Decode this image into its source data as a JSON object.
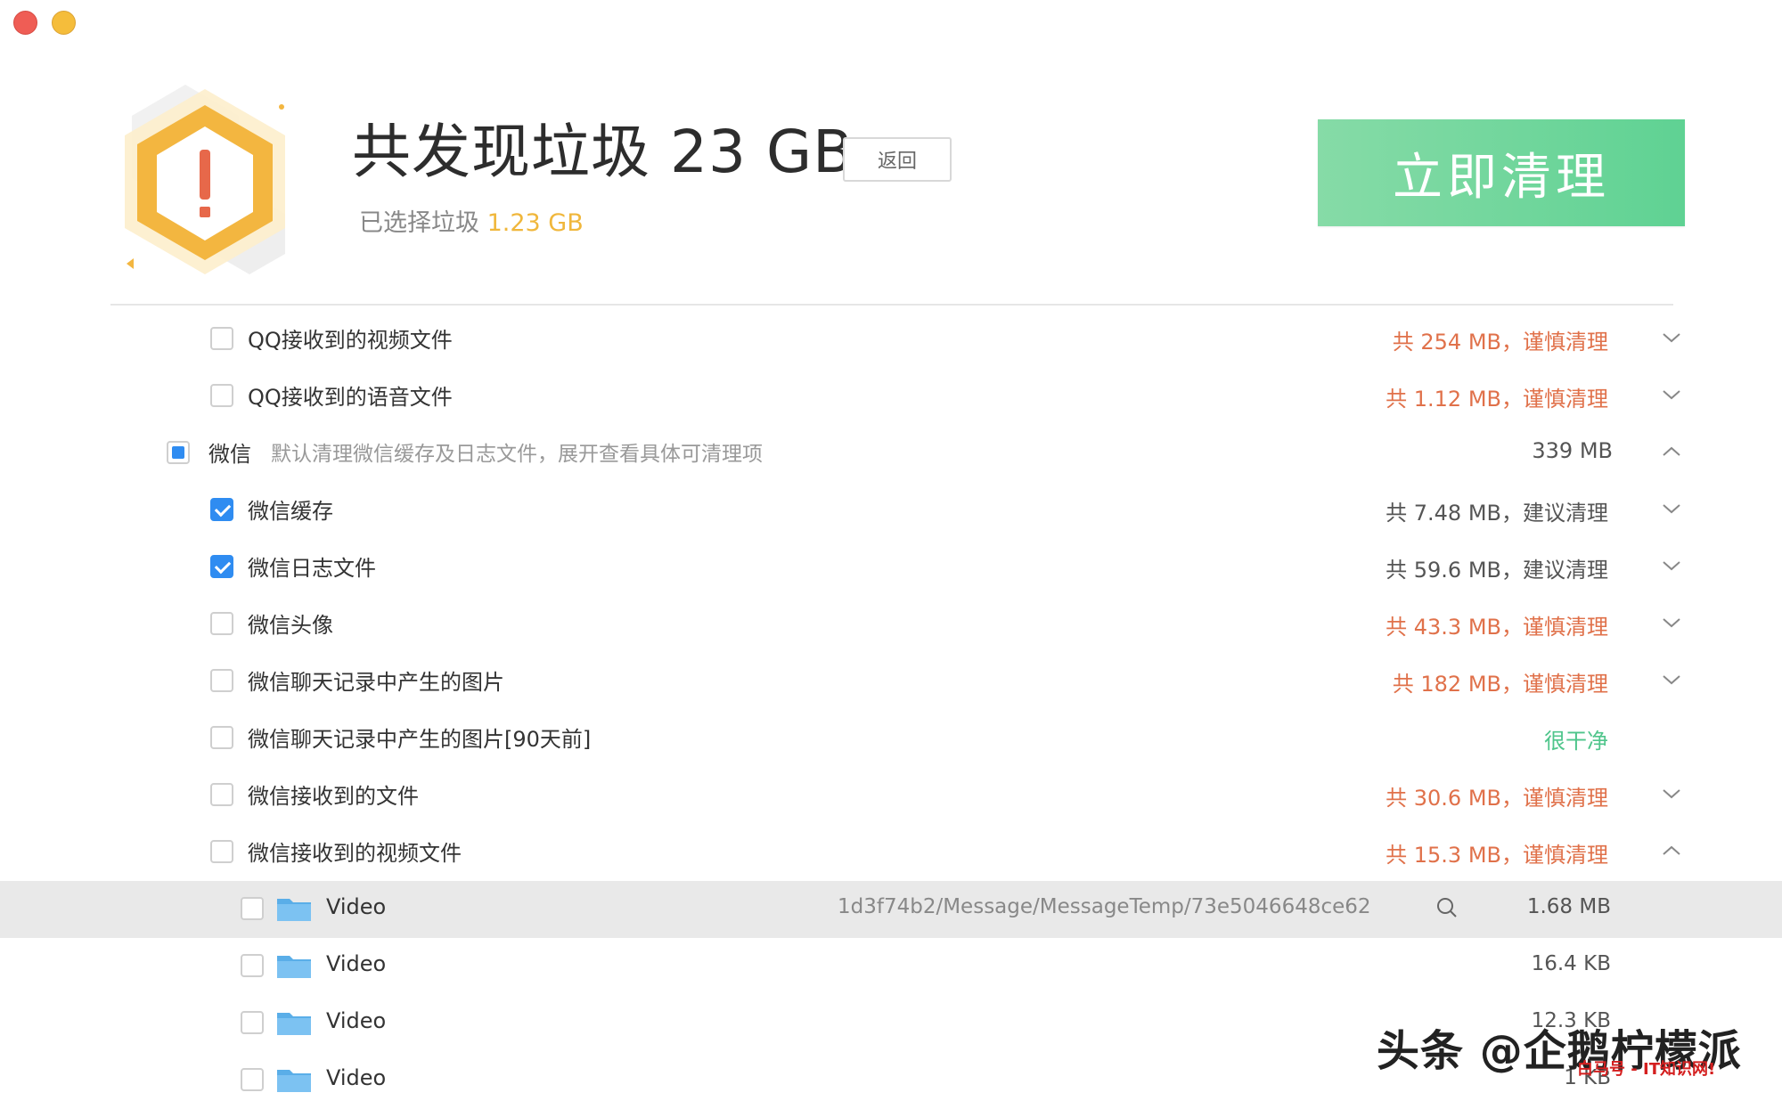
{
  "window": {
    "close_color": "#ef5d55",
    "minimize_color": "#f5bd3b"
  },
  "header": {
    "title": "共发现垃圾 23 GB",
    "back_label": "返回",
    "selected_prefix": "已选择垃圾",
    "selected_size": "1.23 GB",
    "clean_label": "立即清理",
    "accent_green": "#6dd69b",
    "warning_icon": "warning-hexagon-icon"
  },
  "items": [
    {
      "label": "QQ接收到的视频文件",
      "status": "共 254 MB，谨慎清理"
    },
    {
      "label": "QQ接收到的语音文件",
      "status": "共 1.12 MB，谨慎清理"
    },
    {
      "label": "微信",
      "desc": "默认清理微信缓存及日志文件，展开查看具体可清理项",
      "status": "339 MB"
    },
    {
      "label": "微信缓存",
      "status": "共 7.48 MB，建议清理"
    },
    {
      "label": "微信日志文件",
      "status": "共 59.6 MB，建议清理"
    },
    {
      "label": "微信头像",
      "status": "共 43.3 MB，谨慎清理"
    },
    {
      "label": "微信聊天记录中产生的图片",
      "status": "共 182 MB，谨慎清理"
    },
    {
      "label": "微信聊天记录中产生的图片[90天前]",
      "status": "很干净"
    },
    {
      "label": "微信接收到的文件",
      "status": "共 30.6 MB，谨慎清理"
    },
    {
      "label": "微信接收到的视频文件",
      "status": "共 15.3 MB，谨慎清理"
    }
  ],
  "files": [
    {
      "name": "Video",
      "path": "1d3f74b2/Message/MessageTemp/73e5046648ce62",
      "size": "1.68 MB"
    },
    {
      "name": "Video",
      "size": "16.4 KB"
    },
    {
      "name": "Video",
      "size": "12.3 KB"
    },
    {
      "name": "Video",
      "size": "1 KB"
    }
  ],
  "watermark": {
    "text": "头条 @企鹅柠檬派",
    "sub": "白马号 - IT知识网!"
  }
}
